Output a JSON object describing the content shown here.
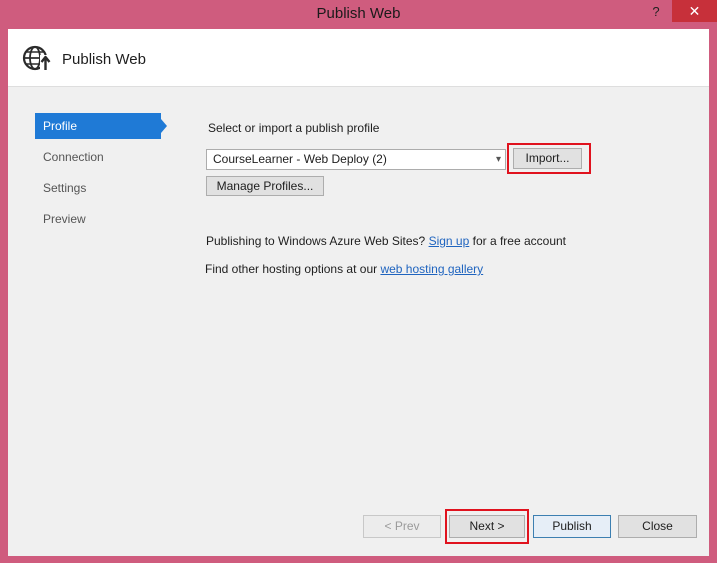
{
  "window": {
    "title": "Publish Web",
    "help_glyph": "?",
    "close_glyph": "✕"
  },
  "header": {
    "title": "Publish Web",
    "icon": "globe-publish-icon"
  },
  "sidebar": {
    "items": [
      {
        "label": "Profile",
        "active": true
      },
      {
        "label": "Connection",
        "active": false
      },
      {
        "label": "Settings",
        "active": false
      },
      {
        "label": "Preview",
        "active": false
      }
    ]
  },
  "profile": {
    "instruction": "Select or import a publish profile",
    "selected_profile": "CourseLearner - Web Deploy (2)",
    "import_label": "Import...",
    "manage_label": "Manage Profiles...",
    "azure_text": "Publishing to Windows Azure Web Sites?",
    "azure_link": "Sign up",
    "azure_suffix": "for a free account",
    "hosting_text": "Find other hosting options at our",
    "hosting_link": "web hosting gallery"
  },
  "footer": {
    "prev_label": "< Prev",
    "next_label": "Next >",
    "publish_label": "Publish",
    "close_label": "Close"
  },
  "colors": {
    "frame": "#cf5c7e",
    "accent": "#1f7ad6",
    "highlight": "#e0121e",
    "link": "#1f64bf"
  }
}
